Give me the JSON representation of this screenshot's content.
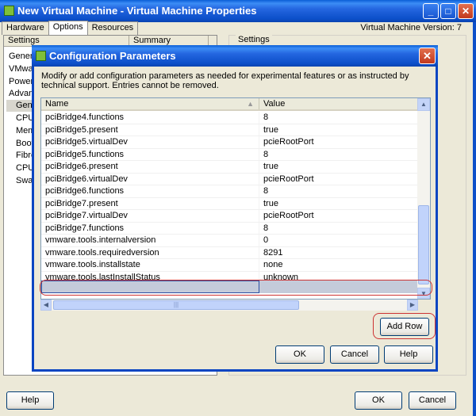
{
  "outer_window": {
    "title": "New Virtual Machine - Virtual Machine Properties",
    "tabs": [
      "Hardware",
      "Options",
      "Resources"
    ],
    "active_tab": "Options",
    "vm_version": "Virtual Machine Version: 7",
    "left_panel": {
      "headers": [
        "Settings",
        "Summary"
      ],
      "items": [
        "Genera",
        "VMware",
        "Power M",
        "Advanc",
        "Gene",
        "CPUI",
        "Memo",
        "Boot",
        "Fibre",
        "CPU/",
        "Swap"
      ]
    },
    "right_panel_legend": "Settings",
    "buttons": {
      "help": "Help",
      "ok": "OK",
      "cancel": "Cancel"
    }
  },
  "dialog": {
    "title": "Configuration Parameters",
    "description": "Modify or add configuration parameters as needed for experimental features or as instructed by technical support. Entries cannot be removed.",
    "columns": {
      "name": "Name",
      "value": "Value"
    },
    "rows": [
      {
        "name": "pciBridge4.functions",
        "value": "8"
      },
      {
        "name": "pciBridge5.present",
        "value": "true"
      },
      {
        "name": "pciBridge5.virtualDev",
        "value": "pcieRootPort"
      },
      {
        "name": "pciBridge5.functions",
        "value": "8"
      },
      {
        "name": "pciBridge6.present",
        "value": "true"
      },
      {
        "name": "pciBridge6.virtualDev",
        "value": "pcieRootPort"
      },
      {
        "name": "pciBridge6.functions",
        "value": "8"
      },
      {
        "name": "pciBridge7.present",
        "value": "true"
      },
      {
        "name": "pciBridge7.virtualDev",
        "value": "pcieRootPort"
      },
      {
        "name": "pciBridge7.functions",
        "value": "8"
      },
      {
        "name": "vmware.tools.internalversion",
        "value": "0"
      },
      {
        "name": "vmware.tools.requiredversion",
        "value": "8291"
      },
      {
        "name": "vmware.tools.installstate",
        "value": "none"
      },
      {
        "name": "vmware.tools.lastInstallStatus",
        "value": "unknown"
      }
    ],
    "buttons": {
      "add_row": "Add Row",
      "ok": "OK",
      "cancel": "Cancel",
      "help": "Help"
    }
  },
  "colors": {
    "title_bar": "#0c4fc9",
    "highlight": "#cc3333",
    "selected_row": "#c4cbda"
  }
}
